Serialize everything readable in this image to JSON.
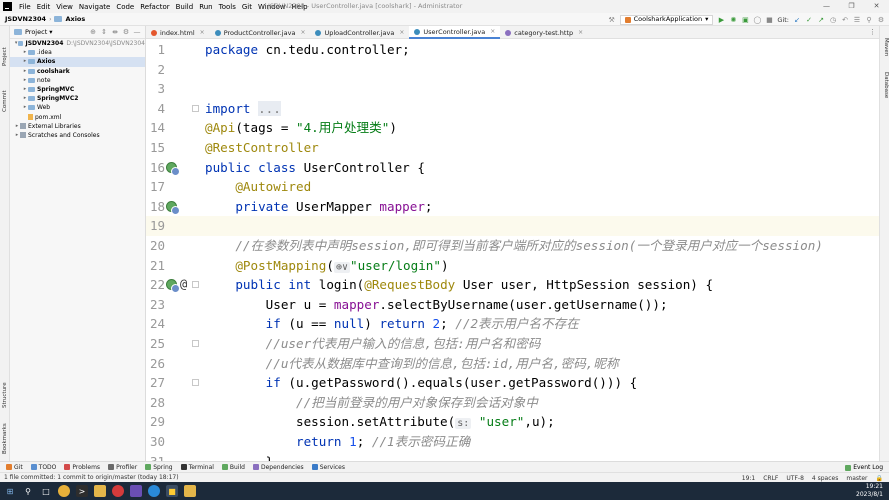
{
  "menu": {
    "items": [
      "File",
      "Edit",
      "View",
      "Navigate",
      "Code",
      "Refactor",
      "Build",
      "Run",
      "Tools",
      "Git",
      "Window",
      "Help"
    ],
    "window_title": "JSDVN2304 - UserController.java [coolshark] - Administrator"
  },
  "nav": {
    "project": "JSDVN2304",
    "module": "Axios",
    "run_config": "CoolsharkApplication",
    "git_label": "Git:"
  },
  "left_strip": {
    "project": "Project",
    "commit": "Commit",
    "structure": "Structure",
    "bookmarks": "Bookmarks"
  },
  "right_strip": {
    "maven": "Maven",
    "database": "Database"
  },
  "project_panel": {
    "title": "Project",
    "tree": [
      {
        "label": "JSDVN2304",
        "path": "D:\\JSDVN2304\\JSDVN2304",
        "depth": 0,
        "type": "folder",
        "expanded": true,
        "bold": true
      },
      {
        "label": ".idea",
        "depth": 1,
        "type": "folder",
        "expanded": false
      },
      {
        "label": "Axios",
        "depth": 1,
        "type": "folder",
        "expanded": false,
        "bold": true,
        "selected": true
      },
      {
        "label": "coolshark",
        "depth": 1,
        "type": "folder",
        "expanded": false,
        "bold": true
      },
      {
        "label": "note",
        "depth": 1,
        "type": "folder",
        "expanded": false
      },
      {
        "label": "SpringMVC",
        "depth": 1,
        "type": "folder",
        "expanded": false,
        "bold": true
      },
      {
        "label": "SpringMVC2",
        "depth": 1,
        "type": "folder",
        "expanded": false,
        "bold": true
      },
      {
        "label": "Web",
        "depth": 1,
        "type": "folder",
        "expanded": false
      },
      {
        "label": "pom.xml",
        "depth": 1,
        "type": "file"
      },
      {
        "label": "External Libraries",
        "depth": 0,
        "type": "lib",
        "expanded": false
      },
      {
        "label": "Scratches and Consoles",
        "depth": 0,
        "type": "lib",
        "expanded": false
      }
    ]
  },
  "tabs": [
    {
      "label": "index.html",
      "color": "#e4572e",
      "active": false
    },
    {
      "label": "ProductController.java",
      "color": "#3c8dbc",
      "active": false
    },
    {
      "label": "UploadController.java",
      "color": "#3c8dbc",
      "active": false
    },
    {
      "label": "UserController.java",
      "color": "#3c8dbc",
      "active": true
    },
    {
      "label": "category-test.http",
      "color": "#8a6fbf",
      "active": false
    }
  ],
  "code_lines": [
    {
      "n": "1",
      "html": "<span class=\"kw\">package</span> cn.tedu.controller;"
    },
    {
      "n": "2",
      "html": ""
    },
    {
      "n": "3",
      "html": ""
    },
    {
      "n": "4",
      "html": "<span class=\"kw\">import</span> <span class=\"fold-txt\">...</span>",
      "fold": true
    },
    {
      "n": "14",
      "html": "<span class=\"ann\">@Api</span>(tags = <span class=\"str\">\"4.用户处理类\"</span>)"
    },
    {
      "n": "15",
      "html": "<span class=\"ann\">@RestController</span>"
    },
    {
      "n": "16",
      "html": "<span class=\"kw\">public class</span> UserController {",
      "icon": true
    },
    {
      "n": "17",
      "html": "    <span class=\"ann\">@Autowired</span>"
    },
    {
      "n": "18",
      "html": "    <span class=\"kw\">private</span> UserMapper <span class=\"fld\">mapper</span>;",
      "icon": true
    },
    {
      "n": "19",
      "html": "",
      "current": true
    },
    {
      "n": "20",
      "html": "    <span class=\"cmt\">//在参数列表中声明session,即可得到当前客户端所对应的session(一个登录用户对应一个session)</span>"
    },
    {
      "n": "21",
      "html": "    <span class=\"ann\">@PostMapping</span>(<span class=\"hint\">⊕∨</span><span class=\"str\">\"user/login\"</span>)"
    },
    {
      "n": "22",
      "html": "    <span class=\"kw\">public int</span> login(<span class=\"ann\">@RequestBody</span> User user, HttpSession session) {",
      "icon": true,
      "at": true,
      "fold": true
    },
    {
      "n": "23",
      "html": "        User u = <span class=\"fld\">mapper</span>.selectByUsername(user.getUsername());"
    },
    {
      "n": "24",
      "html": "        <span class=\"kw\">if</span> (u == <span class=\"kw\">null</span>) <span class=\"kw\">return</span> <span class=\"num\">2</span>; <span class=\"cmt\">//2表示用户名不存在</span>"
    },
    {
      "n": "25",
      "html": "        <span class=\"cmt\">//user代表用户输入的信息,包括:用户名和密码</span>",
      "fold": true
    },
    {
      "n": "26",
      "html": "        <span class=\"cmt\">//u代表从数据库中查询到的信息,包括:id,用户名,密码,昵称</span>"
    },
    {
      "n": "27",
      "html": "        <span class=\"kw\">if</span> (u.getPassword().equals(user.getPassword())) {",
      "fold": true
    },
    {
      "n": "28",
      "html": "            <span class=\"cmt\">//把当前登录的用户对象保存到会话对象中</span>"
    },
    {
      "n": "29",
      "html": "            session.setAttribute(<span class=\"hint\">s:</span> <span class=\"str\">\"user\"</span>,u);"
    },
    {
      "n": "30",
      "html": "            <span class=\"kw\">return</span> <span class=\"num\">1</span>; <span class=\"cmt\">//1表示密码正确</span>"
    },
    {
      "n": "31",
      "html": "        }"
    }
  ],
  "bottom_tools": [
    "Git",
    "TODO",
    "Problems",
    "Profiler",
    "Spring",
    "Terminal",
    "Build",
    "Dependencies",
    "Services"
  ],
  "event_log": "Event Log",
  "status": {
    "message": "1 file committed: 1 commit to origin/master (today 18:17)",
    "position": "19:1",
    "line_sep": "CRLF",
    "encoding": "UTF-8",
    "indent": "4 spaces",
    "branch": "master"
  },
  "taskbar": {
    "time": "19:21",
    "date": "2023/8/1"
  }
}
